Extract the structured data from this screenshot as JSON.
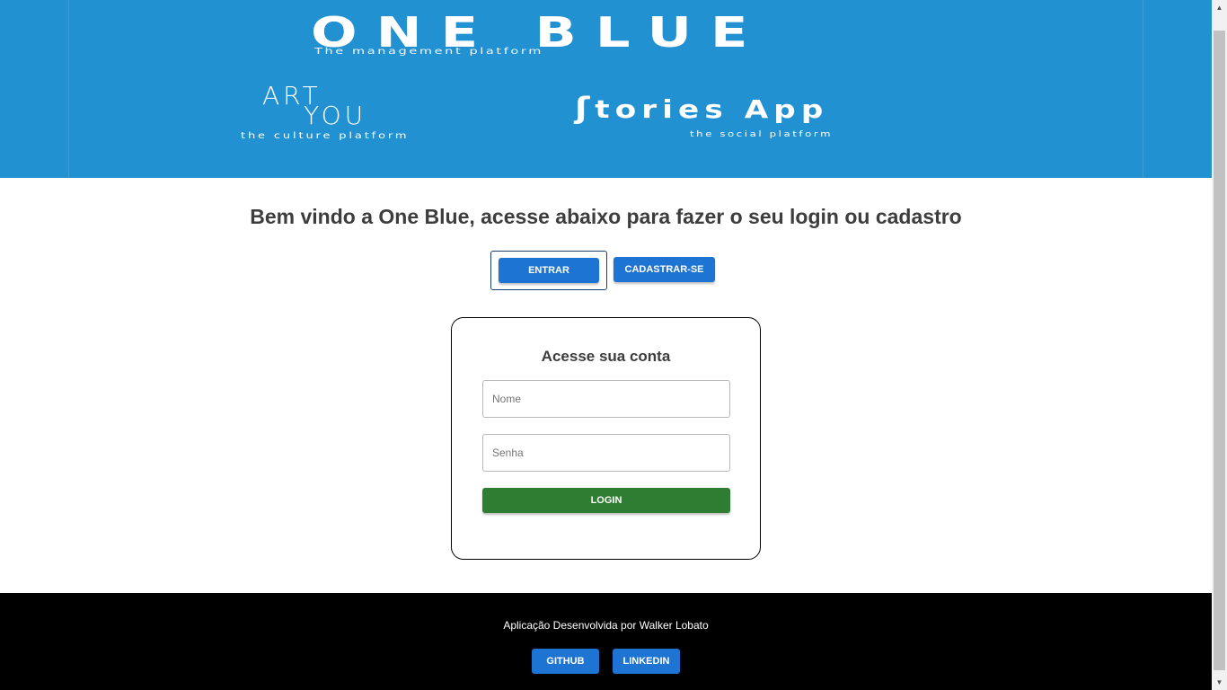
{
  "hero": {
    "one_blue": {
      "title": "ONE BLUE",
      "tagline": "The management platform"
    },
    "art_you": {
      "line1": "ART",
      "line2": "YOU",
      "tagline": "the culture platform"
    },
    "stories": {
      "title": "tories App",
      "tagline": "the social platform"
    },
    "background": "#2191d1"
  },
  "main": {
    "welcome": "Bem vindo a One Blue, acesse abaixo para fazer o seu login ou cadastro",
    "entrar_label": "ENTRAR",
    "cadastrar_label": "CADASTRAR-SE"
  },
  "login_card": {
    "title": "Acesse sua conta",
    "nome_placeholder": "Nome",
    "senha_placeholder": "Senha",
    "login_label": "LOGIN"
  },
  "footer": {
    "credit": "Aplicação Desenvolvida por Walker Lobato",
    "github_label": "GITHUB",
    "linkedin_label": "LINKEDIN"
  },
  "colors": {
    "primary_button": "#1e74d3",
    "login_button": "#2e7d32",
    "footer_bg": "#000000"
  }
}
